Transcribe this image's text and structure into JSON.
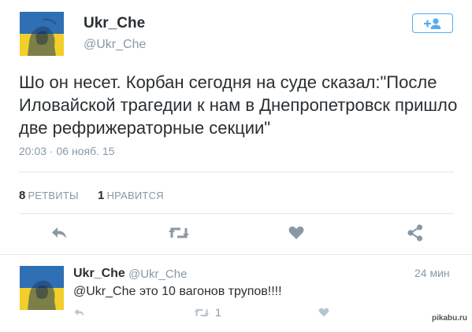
{
  "tweet": {
    "author_name": "Ukr_Che",
    "author_handle": "@Ukr_Che",
    "text": "Шо он несет. Корбан сегодня на суде сказал:\"После Иловайской трагедии к нам в Днепропетровск пришло две рефрижераторные секции\"",
    "timestamp": "20:03 · 06 нояб. 15",
    "retweets_count": "8",
    "retweets_label": "РЕТВИТЫ",
    "likes_count": "1",
    "likes_label": "НРАВИТСЯ",
    "follow_icon": "add-user-icon"
  },
  "actions": {
    "icons": [
      "reply-icon",
      "retweet-icon",
      "heart-icon",
      "share-icon"
    ],
    "icon_color": "#8899a6"
  },
  "reply": {
    "author_name": "Ukr_Che",
    "author_handle": "@Ukr_Che",
    "time": "24 мин",
    "text": "@Ukr_Che это 10 вагонов трупов!!!!",
    "retweet_count": "1"
  },
  "watermark": "pikabu.ru",
  "colors": {
    "accent": "#55acee",
    "flag_blue": "#2f6fb3",
    "flag_yellow": "#f2cf2a",
    "muted": "#8899a6"
  }
}
